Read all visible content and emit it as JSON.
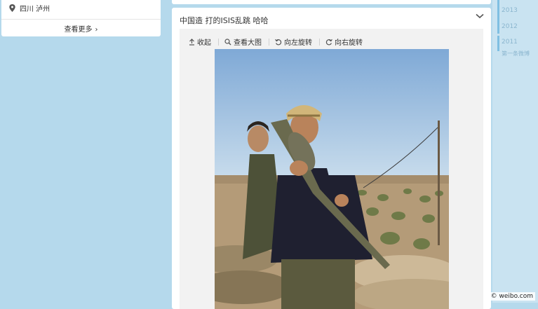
{
  "location_card": {
    "location_text": "四川 泸州",
    "see_more_label": "查看更多"
  },
  "post": {
    "text": "中国造 打的ISIS乱跳 哈哈",
    "toolbar": {
      "collapse_label": "收起",
      "view_large_label": "查看大图",
      "rotate_left_label": "向左旋转",
      "rotate_right_label": "向右旋转"
    }
  },
  "timeline": {
    "years": [
      "2013",
      "2012",
      "2011"
    ],
    "first_label": "第一条微博"
  },
  "watermark": "© weibo.com",
  "colors": {
    "page_background": "#b5d9ec",
    "timeline_accent": "#7fbfe2"
  }
}
